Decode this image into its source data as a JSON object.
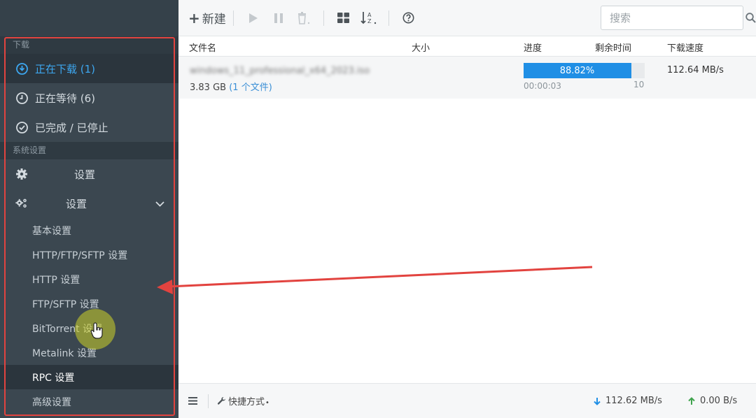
{
  "sidebar": {
    "section_download": "下载",
    "downloading": "正在下载 (1)",
    "waiting": "正在等待 (6)",
    "stopped": "已完成 / 已停止",
    "section_settings": "系统设置",
    "settings_a": "设置",
    "settings_b": "设置",
    "sub_items": [
      "基本设置",
      "HTTP/FTP/SFTP 设置",
      "HTTP 设置",
      "FTP/SFTP 设置",
      "BitTorrent 设置",
      "Metalink 设置",
      "RPC 设置",
      "高级设置"
    ]
  },
  "toolbar": {
    "new_label": "新建",
    "search_placeholder": "搜索"
  },
  "table": {
    "headers": {
      "name": "文件名",
      "size": "大小",
      "progress": "进度",
      "remaining": "剩余时间",
      "speed": "下载速度"
    },
    "rows": [
      {
        "name": "windows_11_professional_x64_2023.iso",
        "size": "3.83 GB",
        "files": "(1 个文件)",
        "progress_pct": 88.82,
        "progress_label": "88.82%",
        "time": "00:00:03",
        "connections": "10",
        "speed": "112.64 MB/s"
      }
    ]
  },
  "footer": {
    "shortcuts": "快捷方式",
    "download_speed": "112.62 MB/s",
    "upload_speed": "0.00 B/s"
  },
  "colors": {
    "accent": "#208fe5",
    "sidebar": "#3b4750",
    "annotation": "#e2433f"
  }
}
